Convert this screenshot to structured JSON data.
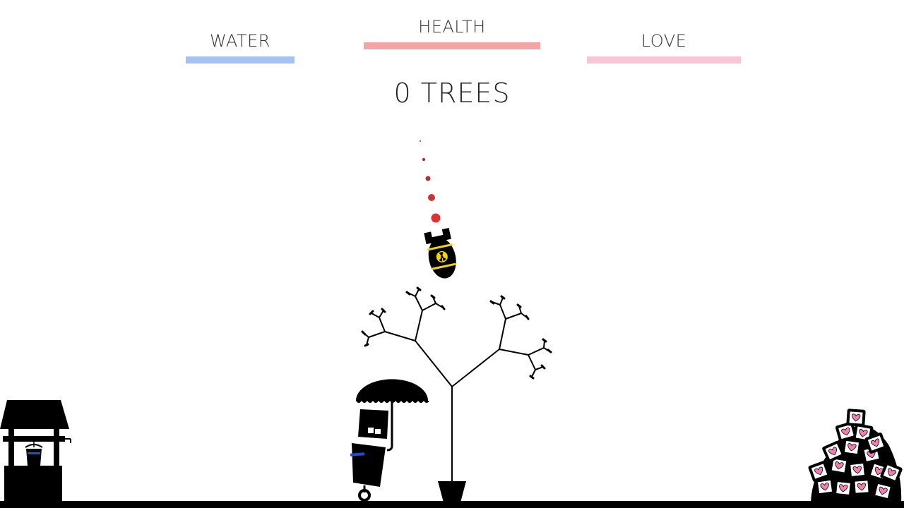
{
  "hud": {
    "water": {
      "label": "WATER",
      "level": 1.0,
      "color": "#a4c2f4"
    },
    "health": {
      "label": "HEALTH",
      "level": 1.0,
      "color": "#f4a4a4"
    },
    "love": {
      "label": "LOVE",
      "level": 1.0,
      "color": "#f9c6d6"
    }
  },
  "score": {
    "tree_count": "0 TREES"
  },
  "colors": {
    "ink": "#000000",
    "bomb_stripe": "#f2d600",
    "trail": "#cc2222",
    "bucket_water": "#1d4fd6",
    "heart": "#f27fb0"
  },
  "scene": {
    "well": "wishing-well-icon",
    "player": "robot-with-umbrella",
    "tree": "fractal-tree-in-pot",
    "bomb": "nuclear-bomb-icon",
    "love_pile": "heart-boxes-pile"
  }
}
